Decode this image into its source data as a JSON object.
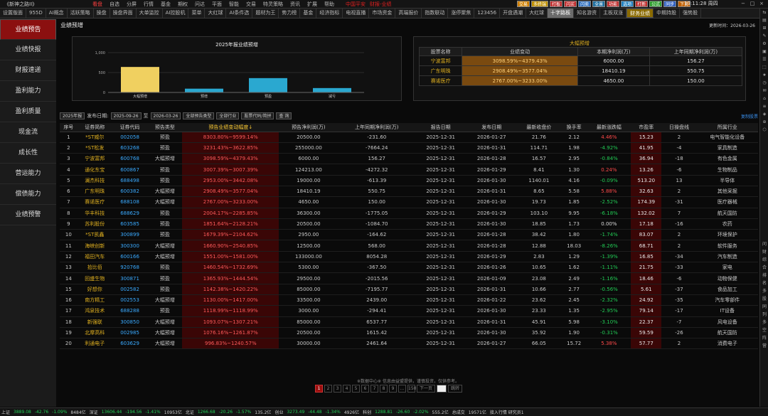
{
  "app": {
    "brand": "《新神之路II》",
    "menu": [
      "看盘",
      "自选",
      "分屏",
      "行情",
      "基金",
      "期权",
      "问达",
      "平面",
      "智能",
      "交易",
      "特灵策略",
      "资讯",
      "扩展",
      "帮助"
    ],
    "active_menu": "看盘",
    "red_notice": "中国平安",
    "red_notice2": "财报-业绩",
    "clock": "19:11:28 周四"
  },
  "top_tags": [
    {
      "label": "交易",
      "color": "#d08000"
    },
    {
      "label": "多终端",
      "color": "#c09000"
    },
    {
      "label": "打板",
      "color": "#c03030"
    },
    {
      "label": "闪买",
      "color": "#c03030"
    },
    {
      "label": "闪卖",
      "color": "#3070c0"
    },
    {
      "label": "全景",
      "color": "#2070a0"
    },
    {
      "label": "功能",
      "color": "#c03030"
    },
    {
      "label": "选项",
      "color": "#2080c0"
    },
    {
      "label": "打新",
      "color": "#c03030"
    },
    {
      "label": "公式",
      "color": "#30a030"
    },
    {
      "label": "同步",
      "color": "#3060c0"
    },
    {
      "label": "下页",
      "color": "#c06000"
    }
  ],
  "tabs": [
    "设置版面",
    "955D",
    "AI概念",
    "活跃策略",
    "操盘",
    "操盘界面",
    "大单监控",
    "AI控股机",
    "菜单",
    "大红球",
    "AI条件选",
    "题材为王",
    "势力榜",
    "基金",
    "经济指标",
    "电视直播",
    "市场资金",
    "高端报价",
    "指数联动",
    "涨停聚焦",
    "123456",
    "开盘遇潮",
    "大红球",
    "十字路板",
    "知名游资",
    "主板双涨",
    "财务业绩",
    "中期持股",
    "强势股"
  ],
  "selected_tab": 26,
  "sidebar": [
    "业绩预告",
    "业绩快报",
    "财报速递",
    "盈利能力",
    "盈利质量",
    "现金流",
    "成长性",
    "营运能力",
    "偿债能力",
    "业绩预警"
  ],
  "right_icons": [
    "⇆",
    "▤",
    "⊞",
    "✎",
    "⚙",
    "▣",
    "☰",
    "⬚",
    "★",
    "◷",
    "✉",
    "⌂",
    "≡",
    "◈",
    "⊕",
    "⬡"
  ],
  "right_chars": [
    "问",
    "财",
    "综",
    "合",
    "排",
    "名",
    "多",
    "股",
    "同",
    "列",
    "多",
    "空",
    "阵",
    "营"
  ],
  "main": {
    "title": "业绩预增",
    "update_label": "更新时间：2026-03-26"
  },
  "chart_data": {
    "type": "bar",
    "title": "2025年报业绩预增",
    "categories": [
      "大幅预增",
      "预增",
      "预盈",
      "减亏"
    ],
    "values": [
      640,
      95,
      360,
      110
    ],
    "ylim": [
      0,
      1000
    ],
    "yticks": [
      0,
      500,
      1000
    ],
    "colors": [
      "#f0d060",
      "#2aa8d0",
      "#2aa8d0",
      "#2aa8d0"
    ]
  },
  "big_increase": {
    "title": "大幅预增",
    "headers": [
      "股票名称",
      "业绩变动",
      "本期净利润(万)",
      "上年同期净利润(万)"
    ],
    "rows": [
      [
        "宁波富邦",
        "3098.59%~4379.43%",
        "6000.00",
        "156.27"
      ],
      [
        "广东明珠",
        "2908.49%~3577.04%",
        "18410.19",
        "550.75"
      ],
      [
        "赛诺医疗",
        "2767.00%~3233.00%",
        "4650.00",
        "150.00"
      ]
    ]
  },
  "filters": {
    "period": "2025年报",
    "date_label": "发布日期:",
    "date_from": "2025-09-26",
    "to_label": "至",
    "date_to": "2026-03-26",
    "type": "全部预告类型",
    "industry": "全部行业",
    "code_input": "股票代码/简拼",
    "search": "查 询",
    "link": "复制股票"
  },
  "table": {
    "headers": [
      "序号",
      "证券简称",
      "证券代码",
      "预告类型",
      "预告业绩变动幅度",
      "预告净利润(万)",
      "上年同期净利润(万)",
      "报告日期",
      "发布日期",
      "最新收盘价",
      "换手率",
      "最新涨跌幅",
      "市盈率",
      "日操盘线",
      "所属行业"
    ],
    "rows": [
      [
        "1",
        "*ST威尔",
        "002058",
        "预盈",
        "8303.80%~9599.14%",
        "20500.00",
        "-231.60",
        "2025-12-31",
        "2026-01-27",
        "21.76",
        "2.12",
        "4.46%",
        "15.23",
        "2",
        "电气智能化设备"
      ],
      [
        "2",
        "*ST松发",
        "603268",
        "预盈",
        "3231.43%~3622.85%",
        "255000.00",
        "-7664.24",
        "2025-12-31",
        "2026-01-31",
        "114.71",
        "1.98",
        "-4.92%",
        "41.95",
        "-4",
        "家具制造"
      ],
      [
        "3",
        "宁波富邦",
        "600768",
        "大幅预增",
        "3098.59%~4379.43%",
        "6000.00",
        "156.27",
        "2025-12-31",
        "2026-01-28",
        "16.57",
        "2.95",
        "-0.84%",
        "36.94",
        "-18",
        "有色金属"
      ],
      [
        "4",
        "通化东宝",
        "600867",
        "预盈",
        "3007.39%~3007.39%",
        "124213.00",
        "-4272.32",
        "2025-12-31",
        "2026-01-29",
        "8.41",
        "1.30",
        "0.24%",
        "13.26",
        "-6",
        "生物制品"
      ],
      [
        "5",
        "澜杰科技",
        "688498",
        "预盈",
        "2953.00%~3442.08%",
        "19000.00",
        "-613.39",
        "2025-12-31",
        "2026-01-30",
        "1140.01",
        "4.16",
        "-0.09%",
        "513.20",
        "13",
        "半导体"
      ],
      [
        "6",
        "广东明珠",
        "600382",
        "大幅预增",
        "2908.49%~3577.04%",
        "18410.19",
        "550.75",
        "2025-12-31",
        "2026-01-31",
        "8.65",
        "5.58",
        "5.88%",
        "32.63",
        "2",
        "其他采掘"
      ],
      [
        "7",
        "赛诺医疗",
        "688108",
        "大幅预增",
        "2767.00%~3233.00%",
        "4650.00",
        "150.00",
        "2025-12-31",
        "2026-01-30",
        "19.73",
        "1.85",
        "-2.52%",
        "174.39",
        "-31",
        "医疗器械"
      ],
      [
        "8",
        "华丰科技",
        "688629",
        "预盈",
        "2004.17%~2285.85%",
        "36300.00",
        "-1775.05",
        "2025-12-31",
        "2026-01-29",
        "103.10",
        "9.95",
        "-6.18%",
        "132.02",
        "7",
        "航天国防"
      ],
      [
        "9",
        "苏利股份",
        "603585",
        "预盈",
        "1851.64%~2128.21%",
        "20500.00",
        "-1084.70",
        "2025-12-31",
        "2026-01-30",
        "18.85",
        "1.73",
        "0.00%",
        "17.18",
        "-16",
        "农药"
      ],
      [
        "10",
        "*ST凯鑫",
        "300899",
        "预盈",
        "1679.39%~2104.62%",
        "2950.00",
        "-164.62",
        "2025-12-31",
        "2026-01-28",
        "38.42",
        "1.80",
        "-1.74%",
        "83.07",
        "2",
        "环境保护"
      ],
      [
        "11",
        "海峡创新",
        "300300",
        "大幅预增",
        "1660.90%~2540.85%",
        "12500.00",
        "568.00",
        "2025-12-31",
        "2026-01-28",
        "12.88",
        "18.03",
        "-8.26%",
        "68.71",
        "2",
        "软件服务"
      ],
      [
        "12",
        "福田汽车",
        "600166",
        "大幅预增",
        "1551.00%~1581.00%",
        "133000.00",
        "8054.28",
        "2025-12-31",
        "2026-01-29",
        "2.83",
        "1.29",
        "-1.39%",
        "16.85",
        "-34",
        "汽车制造"
      ],
      [
        "13",
        "拾比佰",
        "920768",
        "预盈",
        "1460.54%~1732.69%",
        "5300.00",
        "-367.50",
        "2025-12-31",
        "2026-01-26",
        "10.65",
        "1.62",
        "-1.11%",
        "21.75",
        "-33",
        "家电"
      ],
      [
        "14",
        "回盛生物",
        "300871",
        "预盈",
        "1365.93%~1444.54%",
        "29500.00",
        "-2015.56",
        "2025-12-31",
        "2026-01-09",
        "23.08",
        "2.49",
        "-1.16%",
        "18.46",
        "-6",
        "动物保健"
      ],
      [
        "15",
        "好想你",
        "002582",
        "预盈",
        "1142.38%~1420.22%",
        "85000.00",
        "-7195.77",
        "2025-12-31",
        "2026-01-31",
        "10.66",
        "2.77",
        "-0.56%",
        "5.61",
        "-37",
        "食品加工"
      ],
      [
        "16",
        "南方精工",
        "002553",
        "大幅预增",
        "1130.00%~1417.00%",
        "33500.00",
        "2439.00",
        "2025-12-31",
        "2026-01-22",
        "23.62",
        "2.45",
        "-2.32%",
        "24.92",
        "-35",
        "汽车零部件"
      ],
      [
        "17",
        "鸿泉技术",
        "688288",
        "预盈",
        "1118.99%~1118.99%",
        "3000.00",
        "-294.41",
        "2025-12-31",
        "2026-01-30",
        "23.33",
        "1.35",
        "-2.95%",
        "79.14",
        "-17",
        "IT设备"
      ],
      [
        "18",
        "新强联",
        "300850",
        "大幅预增",
        "1093.07%~1307.21%",
        "85000.00",
        "6537.77",
        "2025-12-31",
        "2026-01-31",
        "45.91",
        "5.98",
        "-3.10%",
        "22.37",
        "-7",
        "风电设备"
      ],
      [
        "19",
        "北摩高科",
        "002985",
        "大幅预增",
        "1076.16%~1261.87%",
        "20500.00",
        "1615.42",
        "2025-12-31",
        "2026-01-30",
        "35.92",
        "1.90",
        "-0.31%",
        "59.59",
        "-26",
        "航天国防"
      ],
      [
        "20",
        "利通电子",
        "603629",
        "大幅预增",
        "996.83%~1240.57%",
        "30000.00",
        "2461.64",
        "2025-12-31",
        "2026-01-27",
        "66.05",
        "15.72",
        "5.38%",
        "57.77",
        "2",
        "消费电子"
      ]
    ]
  },
  "pager": {
    "pages": [
      "1",
      "2",
      "3",
      "4",
      "5",
      "6",
      "7",
      "8",
      "9",
      "...",
      "150"
    ],
    "current": "1",
    "next": "下一页",
    "goto": "跳转"
  },
  "footer": "※数据中心※ 信息由益盟提供，谨慎投资，仅供参考。",
  "status": [
    {
      "t": "上证",
      "c": "w"
    },
    {
      "t": "3889.08",
      "c": "g"
    },
    {
      "t": "-42.76",
      "c": "g"
    },
    {
      "t": "-1.09%",
      "c": "g"
    },
    {
      "t": "8484亿",
      "c": "w"
    },
    {
      "t": "深证",
      "c": "w"
    },
    {
      "t": "13606.44",
      "c": "g"
    },
    {
      "t": "-194.56",
      "c": "g"
    },
    {
      "t": "-1.41%",
      "c": "g"
    },
    {
      "t": "10953亿",
      "c": "w"
    },
    {
      "t": "北证",
      "c": "w"
    },
    {
      "t": "1266.68",
      "c": "g"
    },
    {
      "t": "-20.26",
      "c": "g"
    },
    {
      "t": "-1.57%",
      "c": "g"
    },
    {
      "t": "135.2亿",
      "c": "w"
    },
    {
      "t": "创业",
      "c": "w"
    },
    {
      "t": "3273.49",
      "c": "g"
    },
    {
      "t": "-44.48",
      "c": "g"
    },
    {
      "t": "-1.34%",
      "c": "g"
    },
    {
      "t": "4926亿",
      "c": "w"
    },
    {
      "t": "科创",
      "c": "w"
    },
    {
      "t": "1288.81",
      "c": "g"
    },
    {
      "t": "-26.60",
      "c": "g"
    },
    {
      "t": "-2.02%",
      "c": "g"
    },
    {
      "t": "555.2亿",
      "c": "w"
    },
    {
      "t": "总成交",
      "c": "w"
    },
    {
      "t": "19571亿",
      "c": "w"
    },
    {
      "t": "接入行情 研究员1",
      "c": "w"
    }
  ]
}
